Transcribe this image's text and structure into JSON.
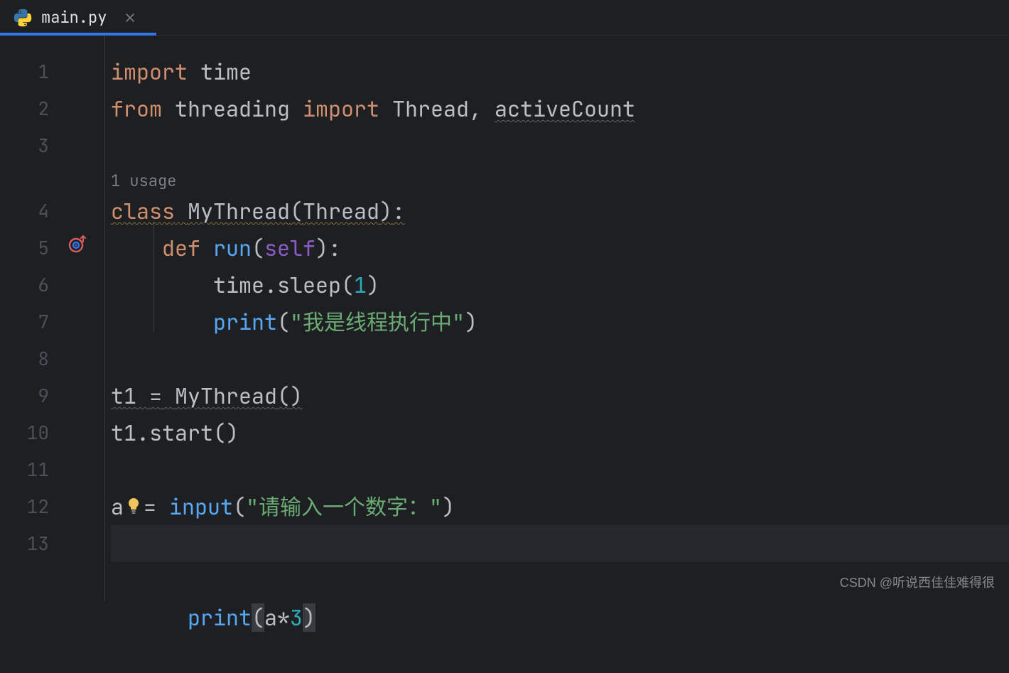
{
  "tab": {
    "filename": "main.py",
    "icon": "python-icon"
  },
  "gutter": {
    "line_numbers": [
      "1",
      "2",
      "3",
      "4",
      "5",
      "6",
      "7",
      "8",
      "9",
      "10",
      "11",
      "12",
      "13"
    ]
  },
  "usage_hint": "1 usage",
  "code": {
    "line1": {
      "import": "import",
      "sp": " ",
      "module": "time"
    },
    "line2": {
      "from": "from",
      "sp": " ",
      "module": "threading",
      "sp2": " ",
      "import": "import",
      "sp3": " ",
      "cls": "Thread",
      "comma": ",",
      "sp4": " ",
      "fn": "activeCount"
    },
    "line4": {
      "class": "class",
      "sp": " ",
      "name": "MyThread",
      "lp": "(",
      "base": "Thread",
      "rp": ")",
      "colon": ":"
    },
    "line5": {
      "indent": "    ",
      "def": "def",
      "sp": " ",
      "name": "run",
      "lp": "(",
      "self": "self",
      "rp": ")",
      "colon": ":"
    },
    "line6": {
      "indent": "        ",
      "obj": "time",
      "dot": ".",
      "method": "sleep",
      "lp": "(",
      "arg": "1",
      "rp": ")"
    },
    "line7": {
      "indent": "        ",
      "fn": "print",
      "lp": "(",
      "str": "\"我是线程执行中\"",
      "rp": ")"
    },
    "line9": {
      "var": "t1",
      "sp": " ",
      "eq": "=",
      "sp2": " ",
      "cls": "MyThread",
      "lp": "(",
      "rp": ")"
    },
    "line10": {
      "obj": "t1",
      "dot": ".",
      "method": "start",
      "lp": "(",
      "rp": ")"
    },
    "line12": {
      "var": "a",
      "sp": " ",
      "eq": "=",
      "sp2": " ",
      "fn": "input",
      "lp": "(",
      "str": "\"请输入一个数字：\"",
      "rp": ")"
    },
    "line13": {
      "fn": "print",
      "lp": "(",
      "var": "a",
      "op": "*",
      "num": "3",
      "rp": ")"
    }
  },
  "watermark": "CSDN @听说西佳佳难得很",
  "current_line": 13
}
